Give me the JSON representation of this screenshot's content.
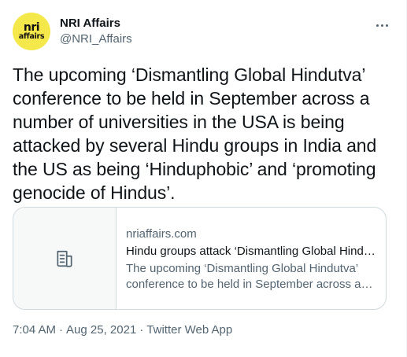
{
  "author": {
    "name": "NRI Affairs",
    "handle": "@NRI_Affairs",
    "avatar_logo": {
      "top": "nri",
      "bottom": "affairs"
    }
  },
  "more_icon": "more-horizontal-icon",
  "tweet": {
    "text": "The upcoming ‘Dismantling Global Hindutva’ conference to be held in September across a number of universities in the USA is being attacked by several Hindu groups in India and the US as being ‘Hinduphobic’ and ‘promoting genocide of Hindus’."
  },
  "link_card": {
    "thumb_icon": "article-icon",
    "domain": "nriaffairs.com",
    "title": "Hindu groups attack ‘Dismantling Global Hindutva’ conference",
    "description": "The upcoming ‘Dismantling Global Hindutva’ conference to be held in September across a number of universities"
  },
  "meta": {
    "time": "7:04 AM",
    "separator": "·",
    "date": "Aug 25, 2021",
    "source": "Twitter Web App"
  },
  "colors": {
    "text_primary": "#0f1419",
    "text_secondary": "#536471",
    "border": "#cfd9de",
    "avatar_bg": "#f5e84a"
  }
}
